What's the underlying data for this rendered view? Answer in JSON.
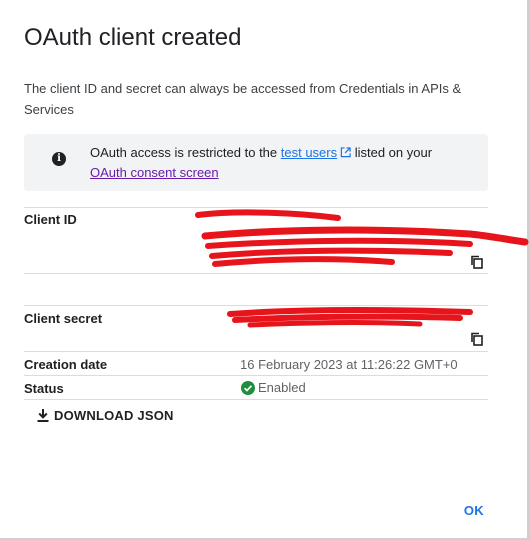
{
  "dialog": {
    "title": "OAuth client created",
    "description": "The client ID and secret can always be accessed from Credentials in APIs & Services"
  },
  "notice": {
    "text_before": "OAuth access is restricted to the ",
    "test_users_link": "test users",
    "text_after": " listed on your ",
    "consent_link": "OAuth consent screen",
    "icon": "info-icon"
  },
  "details": {
    "client_id_label": "Client ID",
    "client_secret_label": "Client secret",
    "creation_date_label": "Creation date",
    "creation_date_value": "16 February 2023 at 11:26:22 GMT+0",
    "status_label": "Status",
    "status_value": "Enabled",
    "status_color": "#1e8e3e",
    "copy_icon": "content-copy-icon"
  },
  "actions": {
    "download_label": "DOWNLOAD JSON",
    "download_icon": "download-icon",
    "ok_label": "OK"
  },
  "colors": {
    "link": "#1a73e8",
    "visited_link": "#681da8",
    "notice_bg": "#f1f3f4",
    "redaction": "#e8141b"
  }
}
